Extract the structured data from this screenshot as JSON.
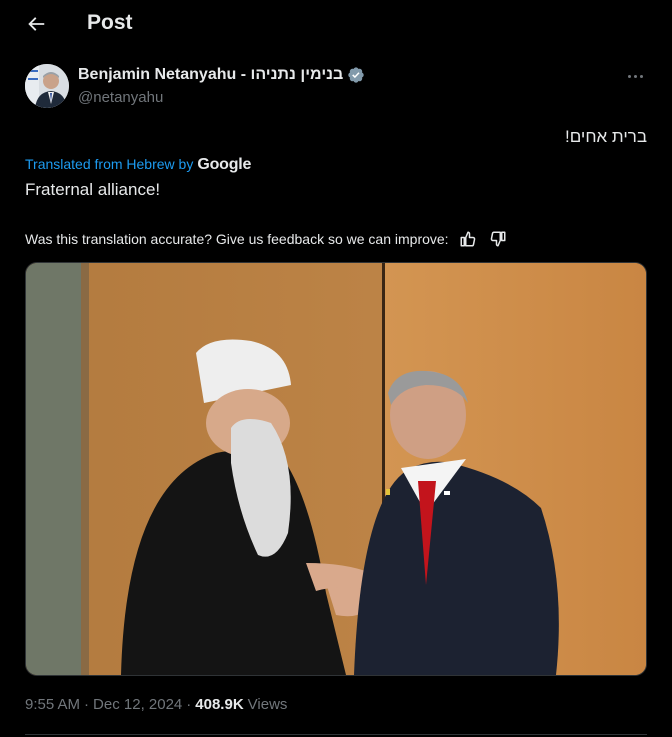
{
  "header": {
    "title": "Post"
  },
  "author": {
    "name": "Benjamin Netanyahu - בנימין נתניהו",
    "handle": "@netanyahu",
    "verified": true
  },
  "post": {
    "original_text": "ברית אחים!",
    "translated_from": "Translated from Hebrew by",
    "translator": "Google",
    "translated_text": "Fraternal alliance!",
    "feedback_prompt": "Was this translation accurate? Give us feedback so we can improve:"
  },
  "meta": {
    "time": "9:55 AM",
    "date": "Dec 12, 2024",
    "views_count": "408.9K",
    "views_label": "Views"
  },
  "colors": {
    "background": "#000000",
    "text": "#e7e9ea",
    "secondary": "#71767b",
    "link": "#1d9bf0",
    "verified": "#829aab"
  }
}
